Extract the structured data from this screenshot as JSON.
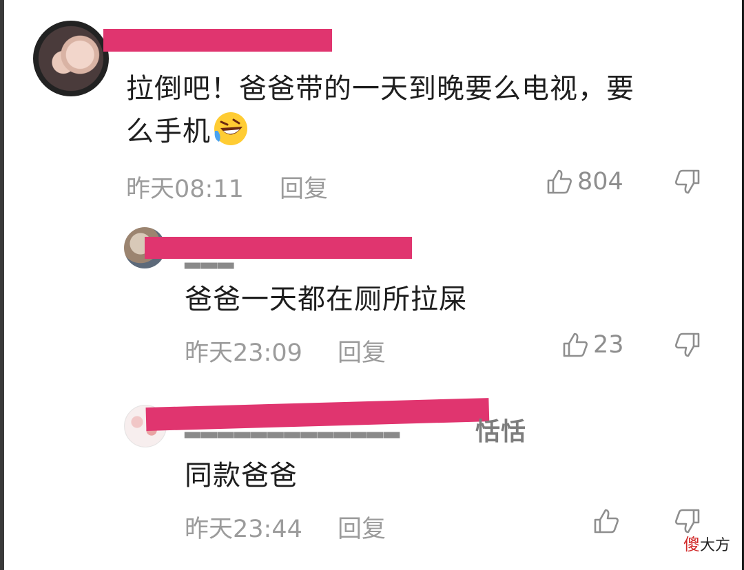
{
  "comments": [
    {
      "text_line1": "拉倒吧！爸爸带的一天到晚要么电视，要",
      "text_line2": "么手机",
      "emoji": "rofl-emoji",
      "time": "昨天08:11",
      "reply_label": "回复",
      "likes": "804"
    },
    {
      "text": "爸爸一天都在厕所拉屎",
      "time": "昨天23:09",
      "reply_label": "回复",
      "likes": "23"
    },
    {
      "name_suffix": "恬恬",
      "text": "同款爸爸",
      "time": "昨天23:44",
      "reply_label": "回复",
      "likes": ""
    }
  ],
  "watermark": {
    "red_char": "傻",
    "rest": "大方"
  },
  "colors": {
    "redaction": "#e0356f",
    "meta_text": "#9b9b9b",
    "body_text": "#1e1e1e"
  },
  "icons": [
    "thumbs-up-icon",
    "thumbs-down-icon",
    "rofl-emoji"
  ]
}
